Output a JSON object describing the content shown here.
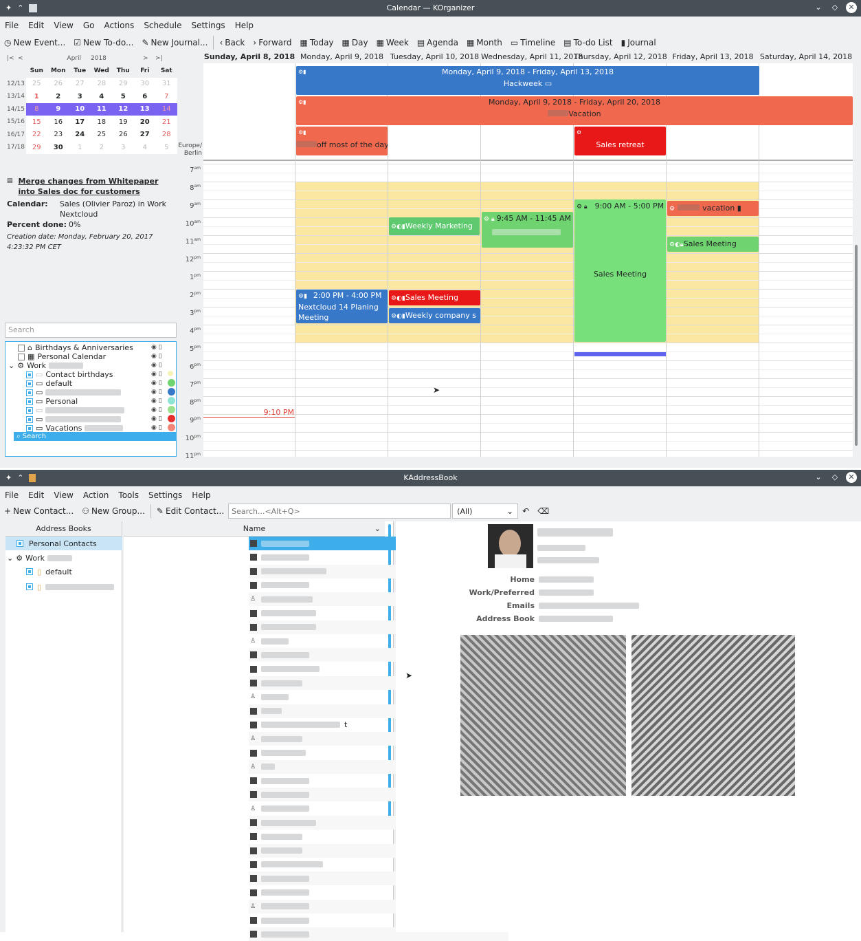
{
  "korganizer": {
    "title": "Calendar — KOrganizer",
    "menu": [
      "File",
      "Edit",
      "View",
      "Go",
      "Actions",
      "Schedule",
      "Settings",
      "Help"
    ],
    "toolbar": {
      "new_event": "New Event...",
      "new_todo": "New To-do...",
      "new_journal": "New Journal...",
      "back": "Back",
      "forward": "Forward",
      "today": "Today",
      "day": "Day",
      "week": "Week",
      "agenda": "Agenda",
      "month": "Month",
      "timeline": "Timeline",
      "todo_list": "To-do List",
      "journal": "Journal"
    },
    "mini_cal": {
      "nav_first": "|<",
      "nav_prev": "<",
      "month": "April",
      "year": "2018",
      "nav_next": ">",
      "nav_last": ">|",
      "dow": [
        "Sun",
        "Mon",
        "Tue",
        "Wed",
        "Thu",
        "Fri",
        "Sat"
      ],
      "weeks": [
        {
          "wk": "12/13",
          "days": [
            "25",
            "26",
            "27",
            "28",
            "29",
            "30",
            "31"
          ]
        },
        {
          "wk": "13/14",
          "days": [
            "1",
            "2",
            "3",
            "4",
            "5",
            "6",
            "7"
          ]
        },
        {
          "wk": "14/15",
          "days": [
            "8",
            "9",
            "10",
            "11",
            "12",
            "13",
            "14"
          ]
        },
        {
          "wk": "15/16",
          "days": [
            "15",
            "16",
            "17",
            "18",
            "19",
            "20",
            "21"
          ]
        },
        {
          "wk": "16/17",
          "days": [
            "22",
            "23",
            "24",
            "25",
            "26",
            "27",
            "28"
          ]
        },
        {
          "wk": "17/18",
          "days": [
            "29",
            "30",
            "1",
            "2",
            "3",
            "4",
            "5"
          ]
        }
      ]
    },
    "todo": {
      "title": "Merge changes from Whitepaper into Sales doc for customers",
      "calendar_label": "Calendar:",
      "calendar_value": "Sales (Olivier Paroz) in Work Nextcloud",
      "percent_label": "Percent done:",
      "percent_value": "0%",
      "creation": "Creation date: Monday, February 20, 2017 4:23:32 PM CET"
    },
    "search_placeholder": "Search",
    "calendars": [
      {
        "label": "Birthdays & Anniversaries"
      },
      {
        "label": "Personal Calendar"
      },
      {
        "label": "Work"
      },
      {
        "label": "Contact birthdays"
      },
      {
        "label": "default"
      },
      {
        "label": "Personal"
      },
      {
        "label": "Vacations"
      }
    ],
    "list_search": "Search",
    "timezone": "Europe/ Berlin",
    "days": [
      "Sunday, April 8, 2018",
      "Monday, April 9, 2018",
      "Tuesday, April 10, 2018",
      "Wednesday, April 11, 2018",
      "Thursday, April 12, 2018",
      "Friday, April 13, 2018",
      "Saturday, April 14, 2018"
    ],
    "hours": [
      "7",
      "8",
      "9",
      "10",
      "11",
      "12",
      "1",
      "2",
      "3",
      "4",
      "5",
      "6",
      "7",
      "8",
      "9",
      "10",
      "11"
    ],
    "hour_suffix": [
      "am",
      "am",
      "am",
      "am",
      "am",
      "pm",
      "pm",
      "pm",
      "pm",
      "pm",
      "pm",
      "pm",
      "pm",
      "pm",
      "pm",
      "pm",
      "pm"
    ],
    "allday": {
      "hackweek_range": "Monday, April 9, 2018 - Friday, April 13, 2018",
      "hackweek": "Hackweek",
      "vacation_range": "Monday, April 9, 2018 - Friday, April 20, 2018",
      "vacation": "Vacation",
      "off": "off most of the day",
      "retreat": "Sales retreat"
    },
    "events": {
      "weekly_marketing": "Weekly Marketing",
      "wed_time": "9:45 AM - 11:45 AM",
      "thu_time": "9:00 AM - 5:00 PM",
      "thu_title": "Sales Meeting",
      "fri_vacation": "vacation",
      "fri_sales": "Sales Meeting",
      "mon_time": "2:00 PM - 4:00 PM",
      "mon_title": "Nextcloud 14 Planing Meeting",
      "tue_sales": "Sales Meeting",
      "tue_weekly": "Weekly company s"
    },
    "now": "9:10 PM",
    "colors": {
      "blue": "#3878c8",
      "red": "#f0694f",
      "green": "#6fd46f",
      "yellow": "#fbe7a1",
      "select": "#7b63f2"
    }
  },
  "kaddressbook": {
    "title": "KAddressBook",
    "menu": [
      "File",
      "Edit",
      "View",
      "Action",
      "Tools",
      "Settings",
      "Help"
    ],
    "toolbar": {
      "new_contact": "New Contact...",
      "new_group": "New Group...",
      "edit_contact": "Edit Contact...",
      "search_placeholder": "Search...<Alt+Q>",
      "filter": "(All)"
    },
    "books_header": "Address Books",
    "books": [
      {
        "label": "Personal Contacts"
      },
      {
        "label": "Work"
      },
      {
        "label": "default"
      }
    ],
    "name_header": "Name",
    "last_row_suffix": "t",
    "detail": {
      "home": "Home",
      "work": "Work/Preferred",
      "emails": "Emails",
      "address_book": "Address Book"
    }
  }
}
